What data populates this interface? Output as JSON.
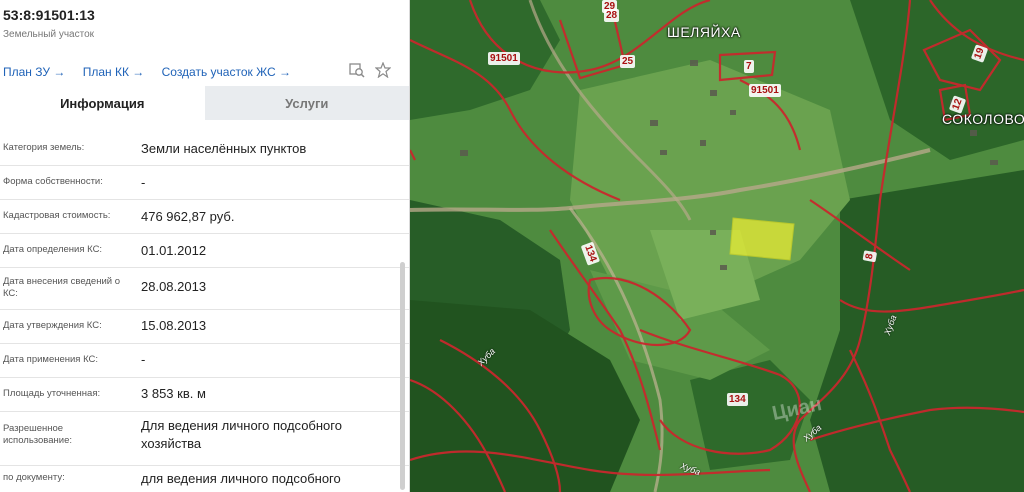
{
  "header": {
    "cadastral_number": "53:8:91501:13",
    "object_type": "Земельный участок"
  },
  "links": [
    "План ЗУ →",
    "План КК →",
    "Создать участок ЖС →"
  ],
  "tabs": {
    "info": "Информация",
    "services": "Услуги"
  },
  "fields": [
    {
      "label": "Категория земель:",
      "value": "Земли населённых пунктов"
    },
    {
      "label": "Форма собственности:",
      "value": "-"
    },
    {
      "label": "Кадастровая стоимость:",
      "value": "476 962,87 руб."
    },
    {
      "label": "Дата определения КС:",
      "value": "01.01.2012"
    },
    {
      "label": "Дата внесения сведений о КС:",
      "value": "28.08.2013"
    },
    {
      "label": "Дата утверждения КС:",
      "value": "15.08.2013"
    },
    {
      "label": "Дата применения КС:",
      "value": "-"
    },
    {
      "label": "Площадь уточненная:",
      "value": "3 853 кв. м"
    },
    {
      "label": "Разрешенное использование:",
      "value": "Для ведения личного подсобного хозяйства"
    },
    {
      "label": "по документу:",
      "value": "для ведения личного подсобного"
    }
  ],
  "map": {
    "villages": [
      "ШЕЛЯЙХА",
      "СОКОЛОВО"
    ],
    "parcel_numbers": [
      "91501",
      "29",
      "28",
      "25",
      "7",
      "91501",
      "19",
      "12",
      "134",
      "8",
      "134"
    ],
    "streets": [
      "Хуба",
      "Хуба",
      "Хуба",
      "Хуба"
    ],
    "watermark": "Циан"
  },
  "colors": {
    "link": "#2063b8",
    "boundary": "#c8282d",
    "highlight": "#f0f032"
  },
  "icons": [
    "arrow-right-icon",
    "search-map-icon",
    "star-icon"
  ]
}
